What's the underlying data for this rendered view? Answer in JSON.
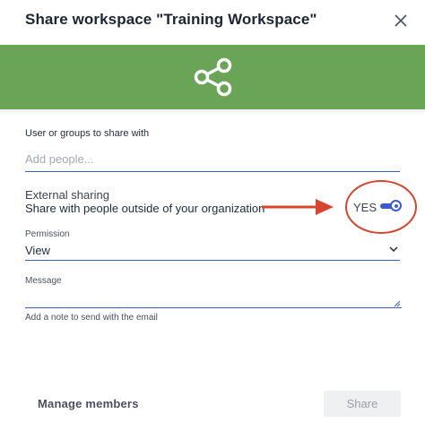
{
  "dialog": {
    "title": "Share workspace \"Training Workspace\"",
    "close_icon": "close-icon"
  },
  "banner": {
    "color": "#6aa456",
    "icon": "share-icon"
  },
  "share_with": {
    "label": "User or groups to share with",
    "placeholder": "Add people..."
  },
  "external_sharing": {
    "title": "External sharing",
    "description": "Share with people outside of your organization",
    "state_label": "YES",
    "enabled": true,
    "accent_color": "#3d5ad1"
  },
  "annotation": {
    "color": "#d8452e"
  },
  "permission": {
    "label": "Permission",
    "value": "View"
  },
  "message": {
    "label": "Message",
    "value": "",
    "hint": "Add a note to send with the email"
  },
  "footer": {
    "manage_label": "Manage members",
    "share_label": "Share"
  }
}
